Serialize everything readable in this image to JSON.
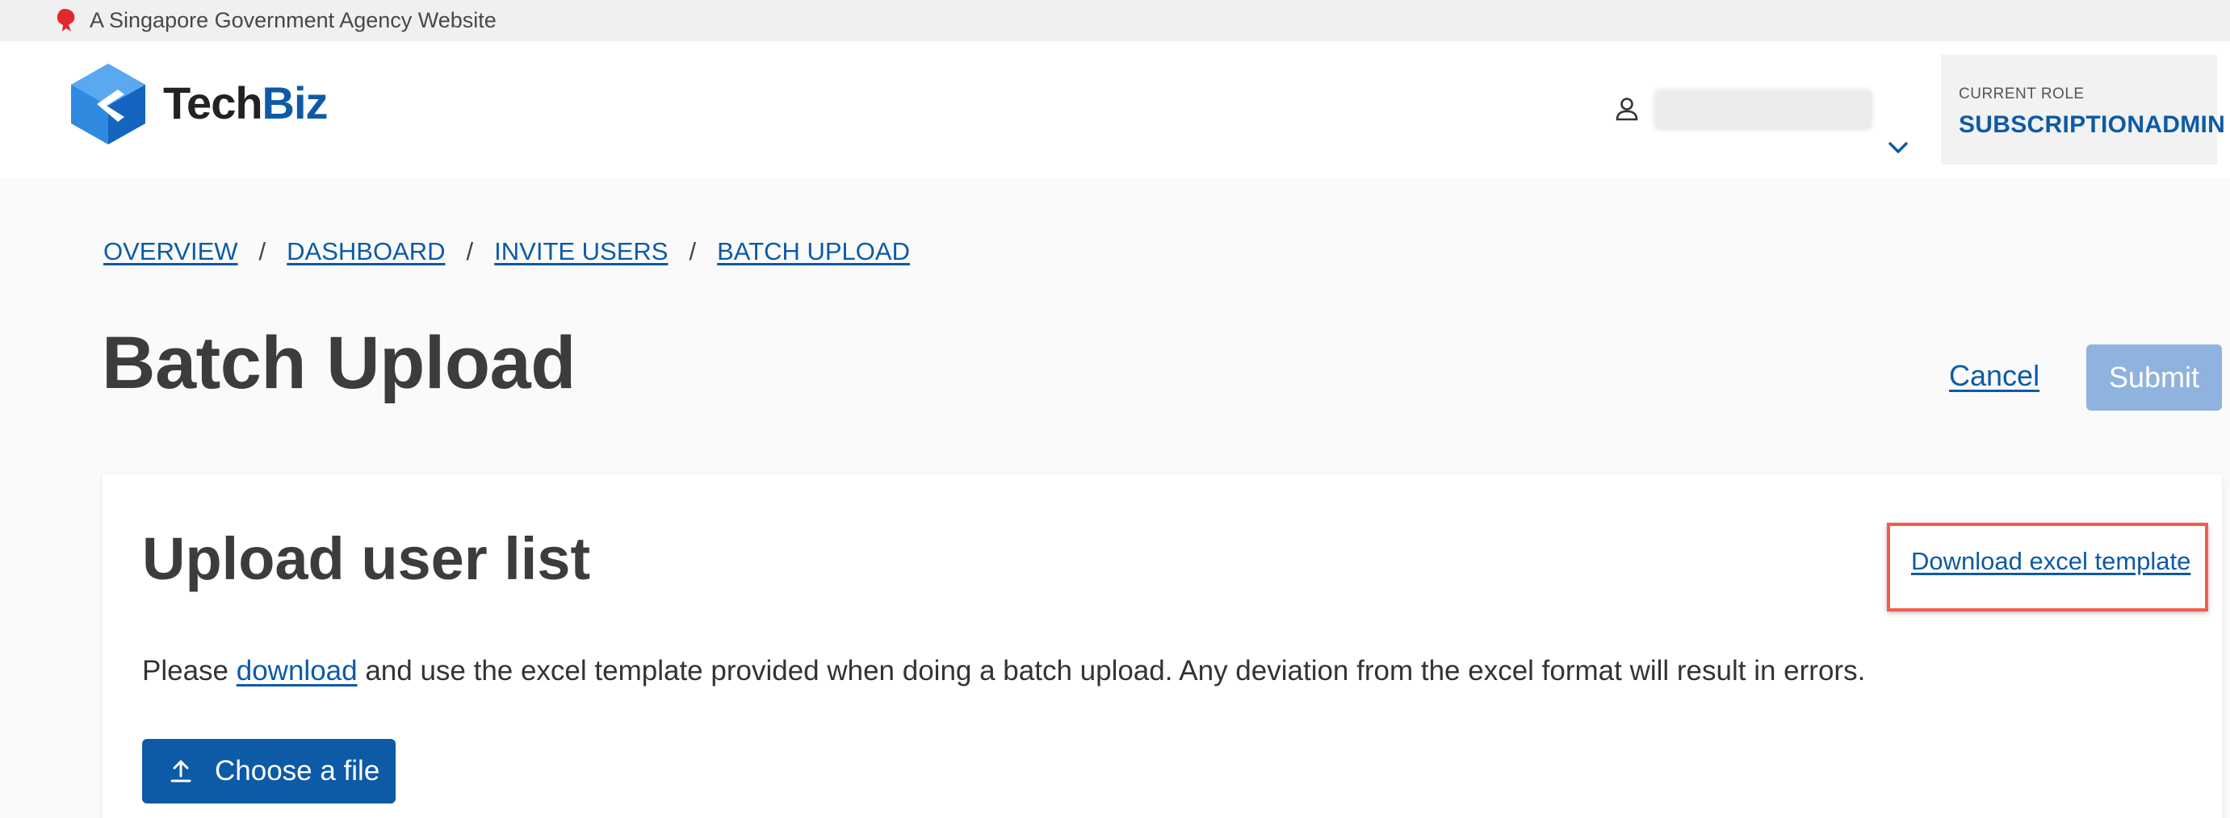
{
  "masthead": {
    "text": "A Singapore Government Agency Website",
    "icon": "lion-head-icon"
  },
  "header": {
    "logo": {
      "tech": "Tech",
      "biz": "Biz"
    },
    "user": {
      "icon": "user-icon",
      "name": "",
      "menu_icon": "chevron-down-icon"
    },
    "role": {
      "label": "CURRENT ROLE",
      "value": "SUBSCRIPTIONADMIN"
    }
  },
  "breadcrumb": [
    "OVERVIEW",
    "DASHBOARD",
    "INVITE USERS",
    "BATCH UPLOAD"
  ],
  "page": {
    "title": "Batch Upload",
    "cancel_label": "Cancel",
    "submit_label": "Submit"
  },
  "card": {
    "title": "Upload user list",
    "download_template_label": "Download excel template",
    "instruction_prefix": "Please ",
    "instruction_link": "download",
    "instruction_suffix": " and use the excel template provided when doing a batch upload. Any deviation from the excel format will result in errors.",
    "choose_file_label": "Choose a file"
  },
  "colors": {
    "primary": "#0d5aa7",
    "submit_disabled": "#8fb3de",
    "highlight_border": "#f25c4c",
    "masthead_bg": "#f0f0f0"
  }
}
